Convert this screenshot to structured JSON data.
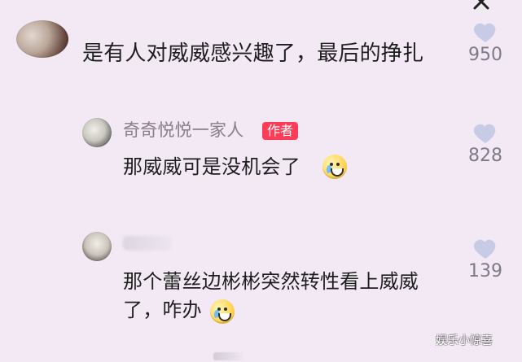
{
  "comments": [
    {
      "text": "是有人对威威感兴趣了，最后的挣扎",
      "likes": "950"
    },
    {
      "author": "奇奇悦悦一家人",
      "badge": "作者",
      "text": "那威威可是没机会了",
      "likes": "828"
    },
    {
      "text_line1": "那个蕾丝边彬彬突然转性看上威威",
      "text_line2": "了，咋办",
      "likes": "139"
    }
  ],
  "watermark": "娱乐小惊喜",
  "icons": {
    "close": "close-icon",
    "like": "heart-icon",
    "emoji": "crying-laugh-emoji"
  },
  "colors": {
    "background": "#f2e9f5",
    "badge": "#ff3b57",
    "heart": "#c7cbe6",
    "muted_text": "#8a7c88"
  }
}
